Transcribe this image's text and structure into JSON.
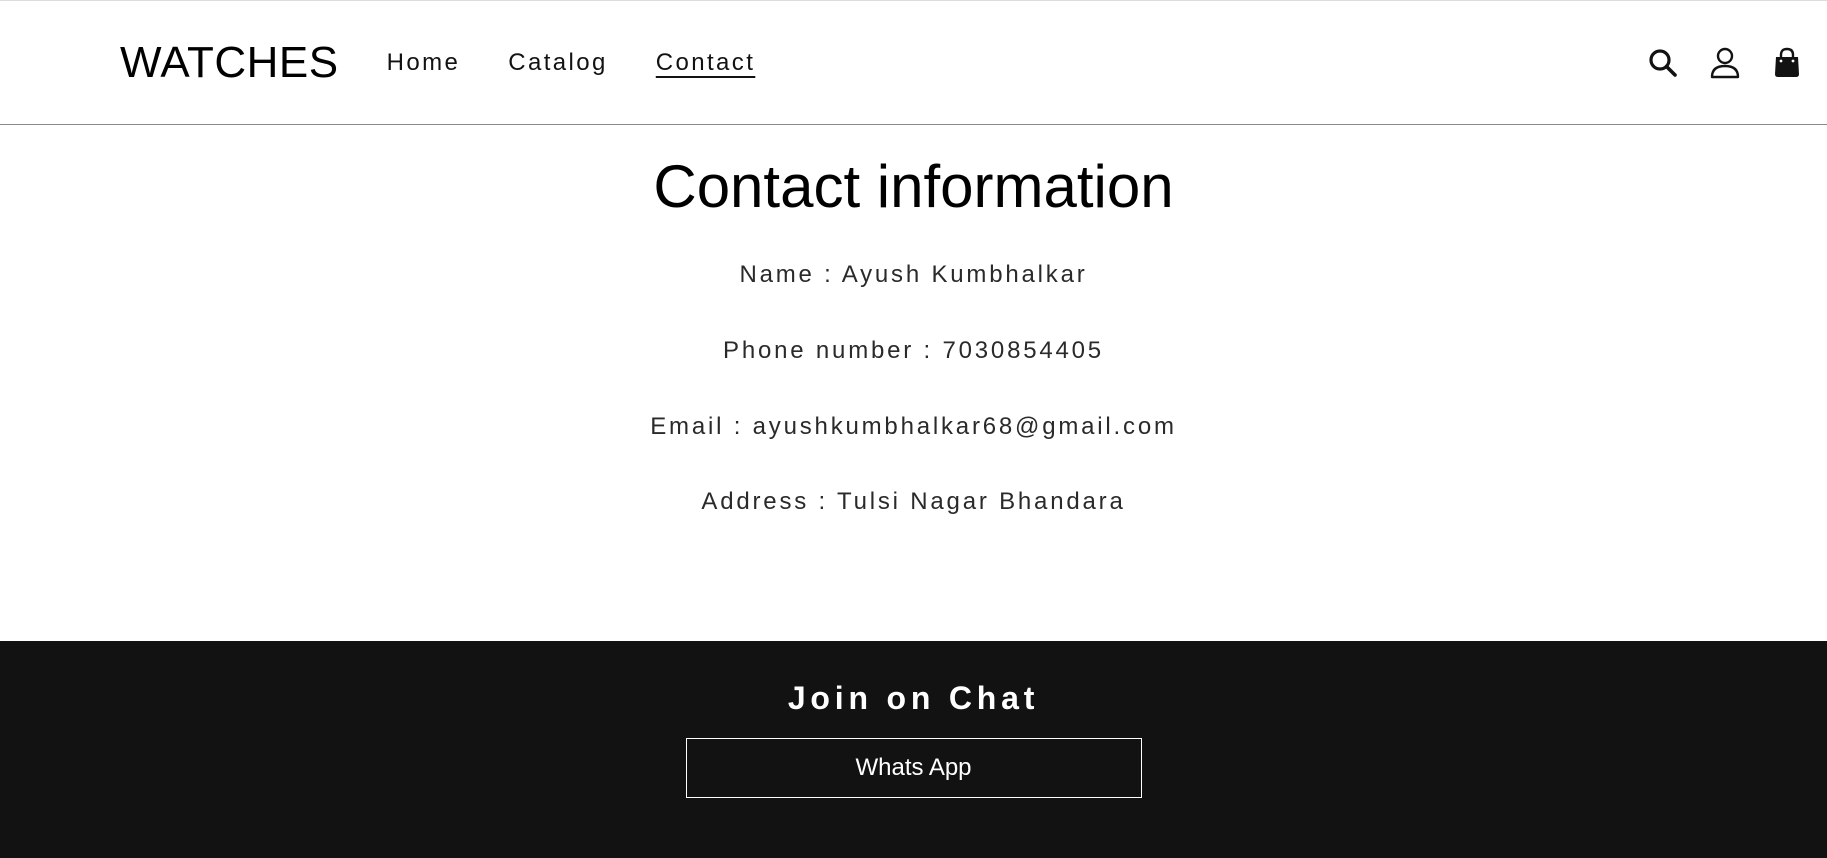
{
  "header": {
    "logo": "WATCHES",
    "nav": {
      "home": "Home",
      "catalog": "Catalog",
      "contact": "Contact"
    },
    "icons": [
      "search-icon",
      "account-icon",
      "cart-icon"
    ]
  },
  "main": {
    "title": "Contact information",
    "name_line": "Name : Ayush Kumbhalkar",
    "phone_line": "Phone number : 7030854405",
    "email_line": "Email : ayushkumbhalkar68@gmail.com",
    "address_line": "Address : Tulsi Nagar Bhandara"
  },
  "footer": {
    "title": "Join on Chat",
    "button_label": "Whats App",
    "background": "#121212"
  }
}
